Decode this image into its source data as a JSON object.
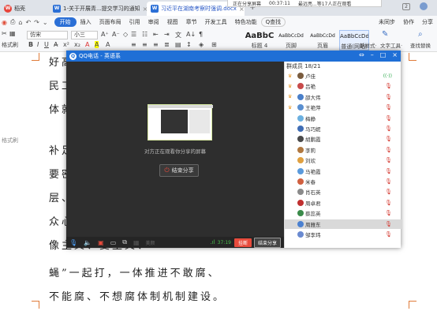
{
  "wps_tabs": {
    "home": "稻壳",
    "doc1": "1-关于开展青...提交学习的通知",
    "doc2": "习近平在湖南考察时强调.docx",
    "close": "×",
    "add": "+"
  },
  "notification": {
    "text1": "正在分享屏幕",
    "time": "00:37:11",
    "text2": "最远亮...等17人正在观看"
  },
  "menu": {
    "items": [
      "开始",
      "插入",
      "页面布局",
      "引用",
      "审阅",
      "视图",
      "章节",
      "开发工具",
      "特色功能"
    ],
    "search": "Q查找",
    "right": [
      "未同步",
      "协作",
      "分享"
    ]
  },
  "ribbon": {
    "font_name": "仿宋",
    "font_size": "小三",
    "format_brush": "格式刷",
    "styles": [
      {
        "preview": "AaBbC",
        "label": "标题 4"
      },
      {
        "preview": "AaBbCcDd",
        "label": "页脚"
      },
      {
        "preview": "AaBbCcDd",
        "label": "页眉"
      },
      {
        "preview": "AaBbCcDd",
        "label": "普通(网站)"
      }
    ],
    "new_style": "新样式·",
    "text_tool": "文字工具·",
    "find_replace": "查找替换"
  },
  "document": {
    "lines": [
      "好高骛",
      "民工、",
      "体就业",
      "补足精",
      "要密切",
      "层、深",
      "众心坎",
      "像主义、变主义、",
      "蝇”一起打，一体推进不敢腐、",
      "不能腐、不想腐体制机制建设。"
    ],
    "side_label": "格式刷"
  },
  "qq": {
    "title": "QQ电话 - 英语系",
    "win_buttons": [
      "⇔",
      "–",
      "□",
      "×"
    ],
    "share_text": "对方正在观看你分享的屏幕",
    "end_share": "结束分享",
    "toolbar": {
      "beauty": "美颜",
      "timer": "37:19",
      "hangup": "挂断",
      "end_share": "结束分享"
    },
    "member_count": "群成员 18/21",
    "members": [
      {
        "name": "卢佳",
        "color": "#7a5c3e",
        "crown": true,
        "mic_on": true
      },
      {
        "name": "吕艳",
        "color": "#c84b4b",
        "crown": true,
        "mic_on": false
      },
      {
        "name": "邵大伟",
        "color": "#4a7fc9",
        "crown": true,
        "mic_on": false
      },
      {
        "name": "王艳萍",
        "color": "#5a8fd0",
        "crown": true,
        "mic_on": false
      },
      {
        "name": "梅静",
        "color": "#6bb0e0",
        "crown": false,
        "mic_on": false
      },
      {
        "name": "马巧妮",
        "color": "#3f6db5",
        "crown": false,
        "mic_on": false
      },
      {
        "name": "胡鹏霞",
        "color": "#4a4a4a",
        "crown": false,
        "mic_on": false
      },
      {
        "name": "李莉",
        "color": "#b07840",
        "crown": false,
        "mic_on": false
      },
      {
        "name": "刘欢",
        "color": "#e0a040",
        "crown": false,
        "mic_on": false
      },
      {
        "name": "马艳霞",
        "color": "#5a9adc",
        "crown": false,
        "mic_on": false
      },
      {
        "name": "米春",
        "color": "#d06040",
        "crown": false,
        "mic_on": false
      },
      {
        "name": "肖石英",
        "color": "#8a8a8a",
        "crown": false,
        "mic_on": false
      },
      {
        "name": "周卓君",
        "color": "#c03030",
        "crown": false,
        "mic_on": false
      },
      {
        "name": "蔡蕊英",
        "color": "#3a8a4a",
        "crown": false,
        "mic_on": false
      },
      {
        "name": "周雅东",
        "color": "#4a80d0",
        "crown": false,
        "mic_on": false,
        "selected": true
      },
      {
        "name": "邹李玮",
        "color": "#6a8ad0",
        "crown": false,
        "mic_on": false
      }
    ]
  }
}
